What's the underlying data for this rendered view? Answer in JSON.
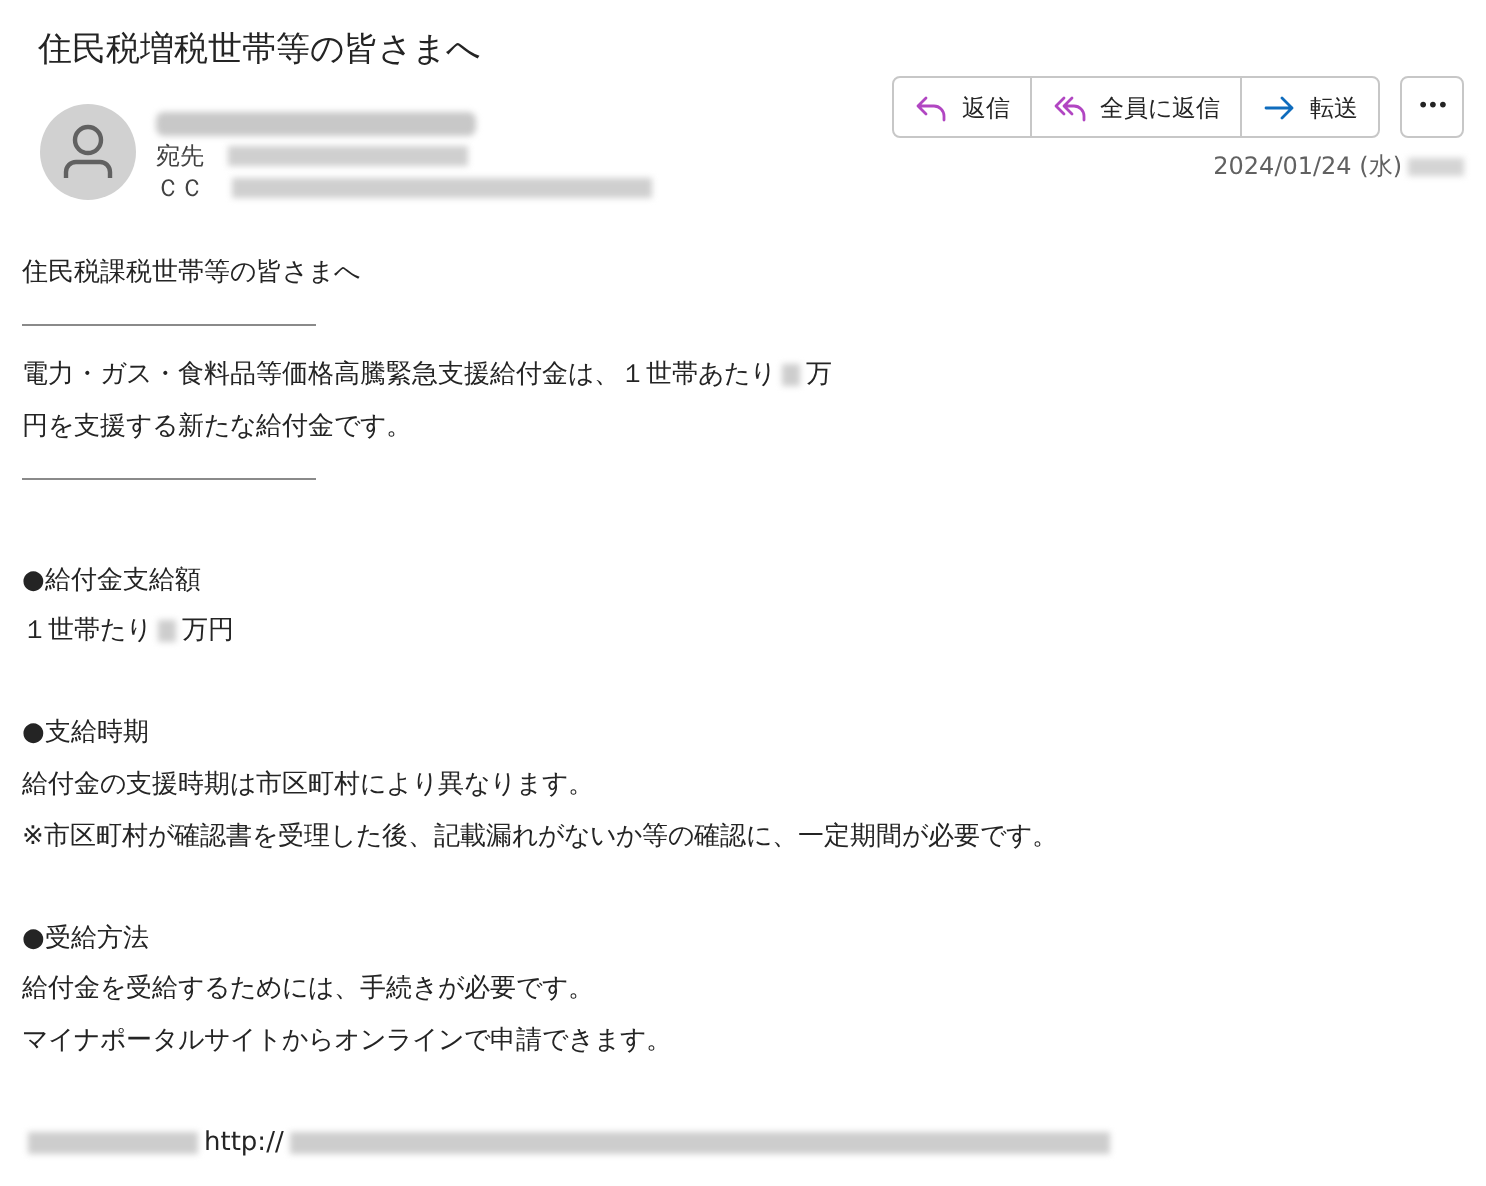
{
  "subject": "住民税増税世帯等の皆さまへ",
  "header": {
    "to_label": "宛先",
    "cc_label": "ＣＣ",
    "date": "2024/01/24 (水)"
  },
  "actions": [
    {
      "label": "返信",
      "kind": "reply"
    },
    {
      "label": "全員に返信",
      "kind": "reply-all"
    },
    {
      "label": "転送",
      "kind": "forward"
    }
  ],
  "more": "•••",
  "body": [
    {
      "kind": "line",
      "segments": [
        {
          "kind": "text",
          "text": "住民税課税世帯等の皆さまへ"
        }
      ]
    },
    {
      "kind": "rule"
    },
    {
      "kind": "line",
      "segments": [
        {
          "kind": "text",
          "text": "電力・ガス・食料品等価格高騰緊急支援給付金は、１世帯あたり"
        },
        {
          "kind": "blur-short"
        },
        {
          "kind": "text",
          "text": "万"
        }
      ]
    },
    {
      "kind": "line",
      "segments": [
        {
          "kind": "text",
          "text": "円を支援する新たな給付金です。"
        }
      ]
    },
    {
      "kind": "rule"
    },
    {
      "kind": "blank"
    },
    {
      "kind": "line",
      "segments": [
        {
          "kind": "text",
          "text": "●給付金支給額"
        }
      ]
    },
    {
      "kind": "line",
      "segments": [
        {
          "kind": "text",
          "text": "１世帯たり"
        },
        {
          "kind": "blur-short"
        },
        {
          "kind": "text",
          "text": "万円"
        }
      ]
    },
    {
      "kind": "blank"
    },
    {
      "kind": "line",
      "segments": [
        {
          "kind": "text",
          "text": "●支給時期"
        }
      ]
    },
    {
      "kind": "line",
      "segments": [
        {
          "kind": "text",
          "text": "給付金の支援時期は市区町村により異なります。"
        }
      ]
    },
    {
      "kind": "line",
      "segments": [
        {
          "kind": "text",
          "text": "※市区町村が確認書を受理した後、記載漏れがないか等の確認に、一定期間が必要です。"
        }
      ]
    },
    {
      "kind": "blank"
    },
    {
      "kind": "line",
      "segments": [
        {
          "kind": "text",
          "text": "●受給方法"
        }
      ]
    },
    {
      "kind": "line",
      "segments": [
        {
          "kind": "text",
          "text": "給付金を受給するためには、手続きが必要です。"
        }
      ]
    },
    {
      "kind": "line",
      "segments": [
        {
          "kind": "text",
          "text": "マイナポータルサイトからオンラインで申請できます。"
        }
      ]
    },
    {
      "kind": "blank"
    },
    {
      "kind": "line",
      "segments": [
        {
          "kind": "blur-medium"
        },
        {
          "kind": "text",
          "text": "http://"
        },
        {
          "kind": "blur-long"
        }
      ]
    }
  ]
}
